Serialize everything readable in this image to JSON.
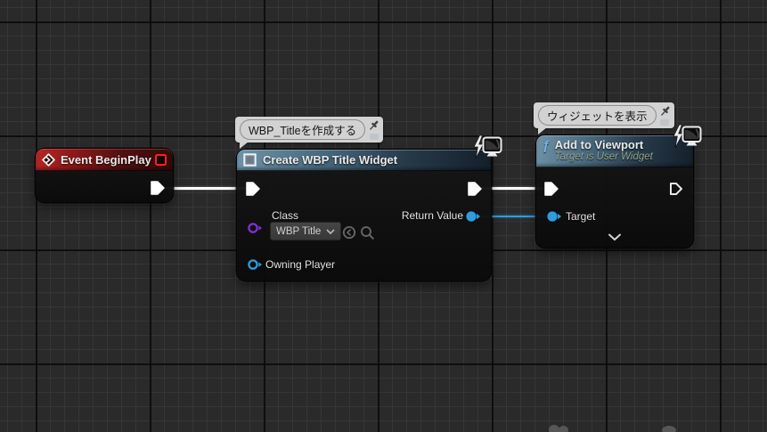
{
  "graph": {
    "comments": [
      {
        "text": "WBP_Titleを作成する"
      },
      {
        "text": "ウィジェットを表示"
      }
    ],
    "nodes": {
      "event_begin_play": {
        "title": "Event BeginPlay"
      },
      "create_widget": {
        "title": "Create WBP Title Widget",
        "class_label": "Class",
        "class_value": "WBP Title",
        "owning_player_label": "Owning Player",
        "return_value_label": "Return Value"
      },
      "add_to_viewport": {
        "fn_icon": "ƒ",
        "title": "Add to Viewport",
        "subtitle": "Target is User Widget",
        "target_label": "Target"
      }
    },
    "colors": {
      "exec_wire": "#ffffff",
      "object_wire": "#2e9ddf",
      "class_pin": "#7e32d8",
      "event_header": "#b62626",
      "function_header": "#6f93a8",
      "comment_bubble": "#d2d2d2"
    }
  }
}
